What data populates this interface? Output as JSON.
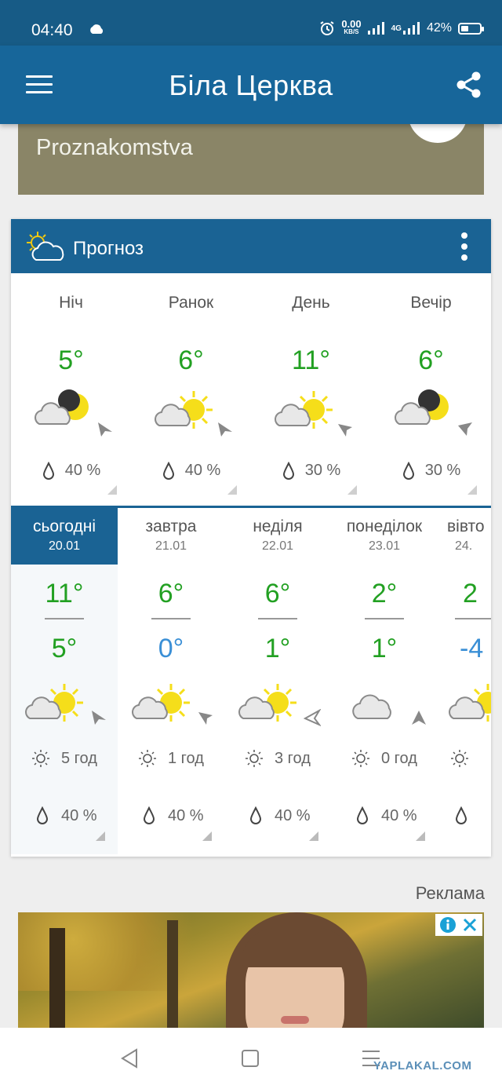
{
  "status_bar": {
    "time": "04:40",
    "net_speed_value": "0.00",
    "net_speed_unit": "KB/S",
    "network": "4G",
    "battery": "42%",
    "battery_level": 0.42
  },
  "app_bar": {
    "title": "Біла Церква"
  },
  "ad_top": {
    "text": "Proznakomstva"
  },
  "forecast": {
    "title": "Прогноз",
    "periods": [
      {
        "name": "Ніч",
        "temp": "5°",
        "rain": "40 %",
        "icon": "cloud-moon-icon"
      },
      {
        "name": "Ранок",
        "temp": "6°",
        "rain": "40 %",
        "icon": "cloud-sun-icon"
      },
      {
        "name": "День",
        "temp": "11°",
        "rain": "30 %",
        "icon": "cloud-sun-icon"
      },
      {
        "name": "Вечір",
        "temp": "6°",
        "rain": "30 %",
        "icon": "cloud-moon-icon"
      }
    ],
    "days": [
      {
        "name": "сьогодні",
        "date": "20.01",
        "high": "11°",
        "low": "5°",
        "sun": "5 год",
        "rain": "40 %",
        "icon": "cloud-sun-icon"
      },
      {
        "name": "завтра",
        "date": "21.01",
        "high": "6°",
        "low": "0°",
        "sun": "1 год",
        "rain": "40 %",
        "icon": "cloud-sun-icon"
      },
      {
        "name": "неділя",
        "date": "22.01",
        "high": "6°",
        "low": "1°",
        "sun": "3 год",
        "rain": "40 %",
        "icon": "cloud-sun-icon"
      },
      {
        "name": "понеділок",
        "date": "23.01",
        "high": "2°",
        "low": "1°",
        "sun": "0 год",
        "rain": "40 %",
        "icon": "cloud-icon"
      },
      {
        "name": "вівто",
        "date": "24.",
        "high": "2",
        "low": "-4",
        "sun": "",
        "rain": "",
        "icon": "cloud-sun-icon"
      }
    ]
  },
  "ad_label": "Реклама",
  "watermark": "YAPLAKAL.COM",
  "colors": {
    "primary": "#1a6394",
    "status_bar": "#175b86",
    "warm_temp": "#22a022",
    "cold_temp": "#3a8fd6"
  }
}
